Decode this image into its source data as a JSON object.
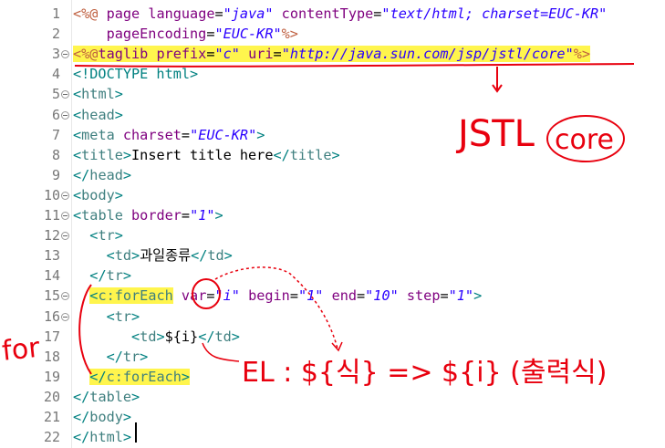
{
  "editor": {
    "lines": [
      {
        "n": "1",
        "fold": false,
        "tokens": [
          [
            "t-dir",
            "<%@"
          ],
          [
            "t-text",
            " "
          ],
          [
            "t-attr",
            "page"
          ],
          [
            "t-text",
            " "
          ],
          [
            "t-attr",
            "language"
          ],
          [
            "t-text",
            "="
          ],
          [
            "t-val",
            "\"java\""
          ],
          [
            "t-text",
            " "
          ],
          [
            "t-attr",
            "contentType"
          ],
          [
            "t-text",
            "="
          ],
          [
            "t-val",
            "\"text/html; charset=EUC-KR\""
          ]
        ]
      },
      {
        "n": "2",
        "fold": false,
        "tokens": [
          [
            "t-text",
            "    "
          ],
          [
            "t-attr",
            "pageEncoding"
          ],
          [
            "t-text",
            "="
          ],
          [
            "t-val",
            "\"EUC-KR\""
          ],
          [
            "t-dir",
            "%>"
          ]
        ]
      },
      {
        "n": "3",
        "fold": true,
        "hl": true,
        "tokens": [
          [
            "t-dir",
            "<%@"
          ],
          [
            "t-attr",
            "taglib"
          ],
          [
            "t-text",
            " "
          ],
          [
            "t-attr",
            "prefix"
          ],
          [
            "t-text",
            "="
          ],
          [
            "t-val",
            "\"c\""
          ],
          [
            "t-text",
            " "
          ],
          [
            "t-attr",
            "uri"
          ],
          [
            "t-text",
            "="
          ],
          [
            "t-val",
            "\"http://java.sun.com/jsp/jstl/core\""
          ],
          [
            "t-dir",
            "%>"
          ]
        ]
      },
      {
        "n": "4",
        "fold": false,
        "tokens": [
          [
            "t-doct",
            "<!DOCTYPE html>"
          ]
        ]
      },
      {
        "n": "5",
        "fold": true,
        "tokens": [
          [
            "t-brack",
            "<"
          ],
          [
            "t-tag",
            "html"
          ],
          [
            "t-brack",
            ">"
          ]
        ]
      },
      {
        "n": "6",
        "fold": true,
        "tokens": [
          [
            "t-brack",
            "<"
          ],
          [
            "t-tag",
            "head"
          ],
          [
            "t-brack",
            ">"
          ]
        ]
      },
      {
        "n": "7",
        "fold": false,
        "tokens": [
          [
            "t-brack",
            "<"
          ],
          [
            "t-tag",
            "meta"
          ],
          [
            "t-text",
            " "
          ],
          [
            "t-attr",
            "charset"
          ],
          [
            "t-text",
            "="
          ],
          [
            "t-val",
            "\"EUC-KR\""
          ],
          [
            "t-brack",
            ">"
          ]
        ]
      },
      {
        "n": "8",
        "fold": false,
        "tokens": [
          [
            "t-brack",
            "<"
          ],
          [
            "t-tag",
            "title"
          ],
          [
            "t-brack",
            ">"
          ],
          [
            "t-text",
            "Insert title here"
          ],
          [
            "t-brack",
            "</"
          ],
          [
            "t-tag",
            "title"
          ],
          [
            "t-brack",
            ">"
          ]
        ]
      },
      {
        "n": "9",
        "fold": false,
        "tokens": [
          [
            "t-brack",
            "</"
          ],
          [
            "t-tag",
            "head"
          ],
          [
            "t-brack",
            ">"
          ]
        ]
      },
      {
        "n": "10",
        "fold": true,
        "tokens": [
          [
            "t-brack",
            "<"
          ],
          [
            "t-tag",
            "body"
          ],
          [
            "t-brack",
            ">"
          ]
        ]
      },
      {
        "n": "11",
        "fold": true,
        "tokens": [
          [
            "t-brack",
            "<"
          ],
          [
            "t-tag",
            "table"
          ],
          [
            "t-text",
            " "
          ],
          [
            "t-attr",
            "border"
          ],
          [
            "t-text",
            "="
          ],
          [
            "t-val",
            "\"1\""
          ],
          [
            "t-brack",
            ">"
          ]
        ]
      },
      {
        "n": "12",
        "fold": true,
        "tokens": [
          [
            "t-text",
            "  "
          ],
          [
            "t-brack",
            "<"
          ],
          [
            "t-tag",
            "tr"
          ],
          [
            "t-brack",
            ">"
          ]
        ]
      },
      {
        "n": "13",
        "fold": false,
        "tokens": [
          [
            "t-text",
            "    "
          ],
          [
            "t-brack",
            "<"
          ],
          [
            "t-tag",
            "td"
          ],
          [
            "t-brack",
            ">"
          ],
          [
            "t-text",
            "과일종류"
          ],
          [
            "t-brack",
            "</"
          ],
          [
            "t-tag",
            "td"
          ],
          [
            "t-brack",
            ">"
          ]
        ]
      },
      {
        "n": "14",
        "fold": false,
        "tokens": [
          [
            "t-text",
            "  "
          ],
          [
            "t-brack",
            "</"
          ],
          [
            "t-tag",
            "tr"
          ],
          [
            "t-brack",
            ">"
          ]
        ]
      },
      {
        "n": "15",
        "fold": true,
        "tokens": [
          [
            "t-text",
            "  "
          ],
          [
            "t-brack hl",
            "<"
          ],
          [
            "t-tag hl",
            "c:forEach"
          ],
          [
            "t-text",
            " "
          ],
          [
            "t-attr",
            "var"
          ],
          [
            "t-text",
            "="
          ],
          [
            "t-val",
            "\"i\""
          ],
          [
            "t-text",
            " "
          ],
          [
            "t-attr",
            "begin"
          ],
          [
            "t-text",
            "="
          ],
          [
            "t-val",
            "\"1\""
          ],
          [
            "t-text",
            " "
          ],
          [
            "t-attr",
            "end"
          ],
          [
            "t-text",
            "="
          ],
          [
            "t-val",
            "\"10\""
          ],
          [
            "t-text",
            " "
          ],
          [
            "t-attr",
            "step"
          ],
          [
            "t-text",
            "="
          ],
          [
            "t-val",
            "\"1\""
          ],
          [
            "t-brack",
            ">"
          ]
        ]
      },
      {
        "n": "16",
        "fold": true,
        "tokens": [
          [
            "t-text",
            "    "
          ],
          [
            "t-brack",
            "<"
          ],
          [
            "t-tag",
            "tr"
          ],
          [
            "t-brack",
            ">"
          ]
        ]
      },
      {
        "n": "17",
        "fold": false,
        "tokens": [
          [
            "t-text",
            "       "
          ],
          [
            "t-brack",
            "<"
          ],
          [
            "t-tag",
            "td"
          ],
          [
            "t-brack",
            ">"
          ],
          [
            "t-text",
            "${i}"
          ],
          [
            "t-brack",
            "</"
          ],
          [
            "t-tag",
            "td"
          ],
          [
            "t-brack",
            ">"
          ]
        ]
      },
      {
        "n": "18",
        "fold": false,
        "tokens": [
          [
            "t-text",
            "    "
          ],
          [
            "t-brack",
            "</"
          ],
          [
            "t-tag",
            "tr"
          ],
          [
            "t-brack",
            ">"
          ]
        ]
      },
      {
        "n": "19",
        "fold": false,
        "tokens": [
          [
            "t-text",
            "  "
          ],
          [
            "t-brack hl",
            "</"
          ],
          [
            "t-tag hl",
            "c:forEach"
          ],
          [
            "t-brack hl",
            ">"
          ]
        ]
      },
      {
        "n": "20",
        "fold": false,
        "tokens": [
          [
            "t-brack",
            "</"
          ],
          [
            "t-tag",
            "table"
          ],
          [
            "t-brack",
            ">"
          ]
        ]
      },
      {
        "n": "21",
        "fold": false,
        "tokens": [
          [
            "t-brack",
            "</"
          ],
          [
            "t-tag",
            "body"
          ],
          [
            "t-brack",
            ">"
          ]
        ]
      },
      {
        "n": "22",
        "fold": false,
        "tokens": [
          [
            "t-brack",
            "</"
          ],
          [
            "t-tag",
            "html"
          ],
          [
            "t-brack",
            ">"
          ]
        ]
      }
    ]
  },
  "annotations": {
    "jstl": "JSTL",
    "core": "core",
    "for": "for",
    "el": "EL : ${식} => ${i} (출력식)"
  },
  "colors": {
    "tag": "#3f7f7f",
    "attribute": "#7f007f",
    "value": "#2a00ff",
    "directive": "#bf5f3f",
    "highlight": "#fff54d",
    "ink": "#e8000e"
  }
}
